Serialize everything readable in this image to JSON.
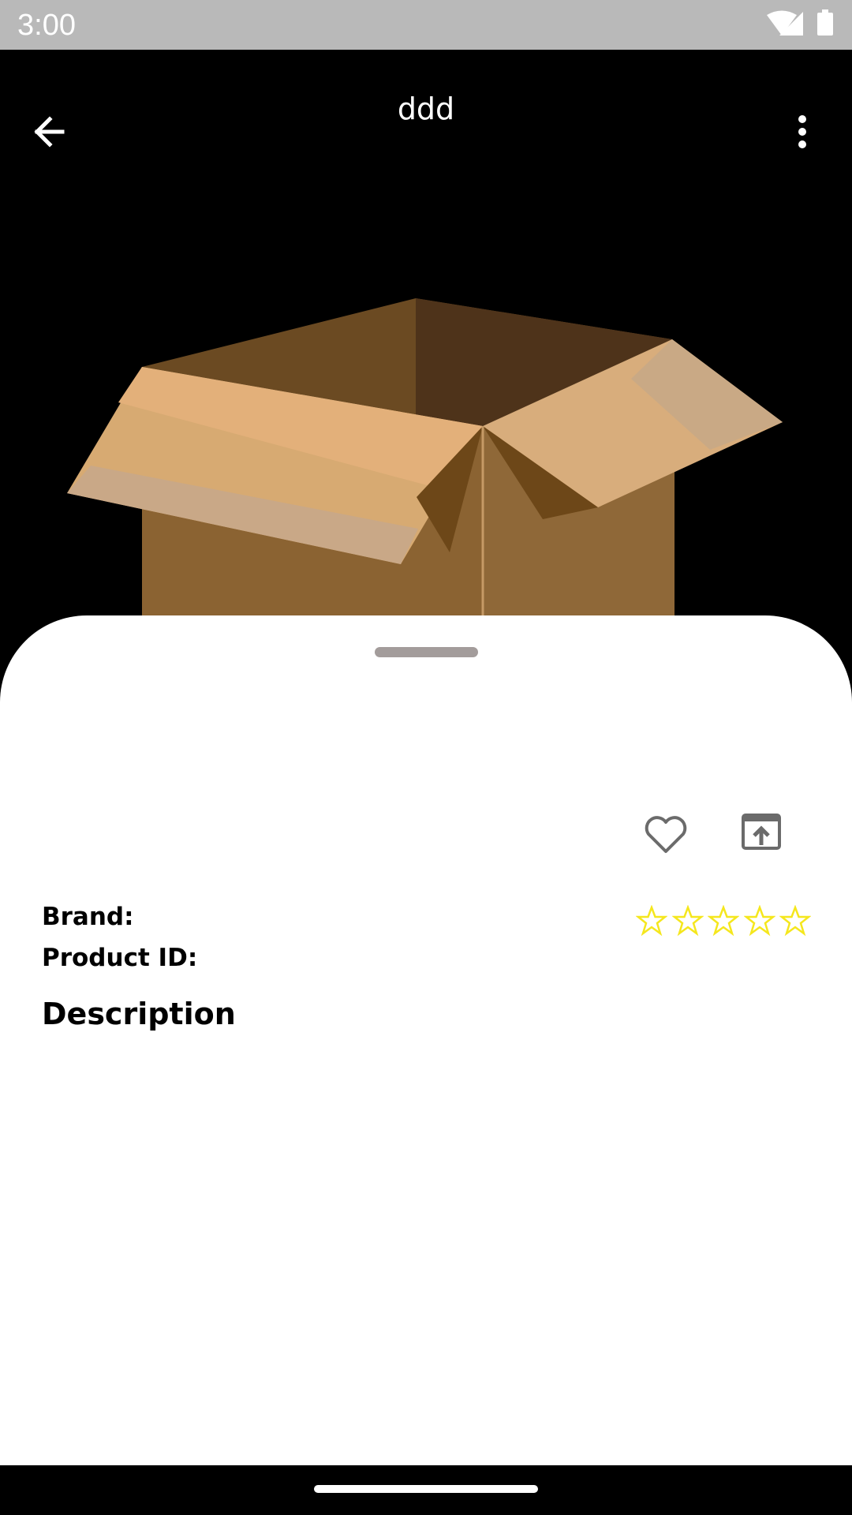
{
  "status_bar": {
    "time": "3:00",
    "icons": [
      "wifi-icon",
      "cellular-signal-icon",
      "battery-icon"
    ]
  },
  "app_bar": {
    "title": "ddd",
    "back_icon": "arrow-back-icon",
    "more_icon": "more-vert-icon"
  },
  "product": {
    "image": "cardboard-box-image",
    "brand_label": "Brand:",
    "product_id_label": "Product ID:",
    "description_heading": "Description",
    "rating": 0,
    "rating_max": 5,
    "favorite_icon": "heart-outline-icon",
    "share_icon": "open-in-browser-icon"
  },
  "colors": {
    "star": "#f5e71d",
    "icon_gray": "#6b6b6b",
    "sheet_handle": "#a39c9b",
    "status_bar": "#b9b9b9"
  }
}
